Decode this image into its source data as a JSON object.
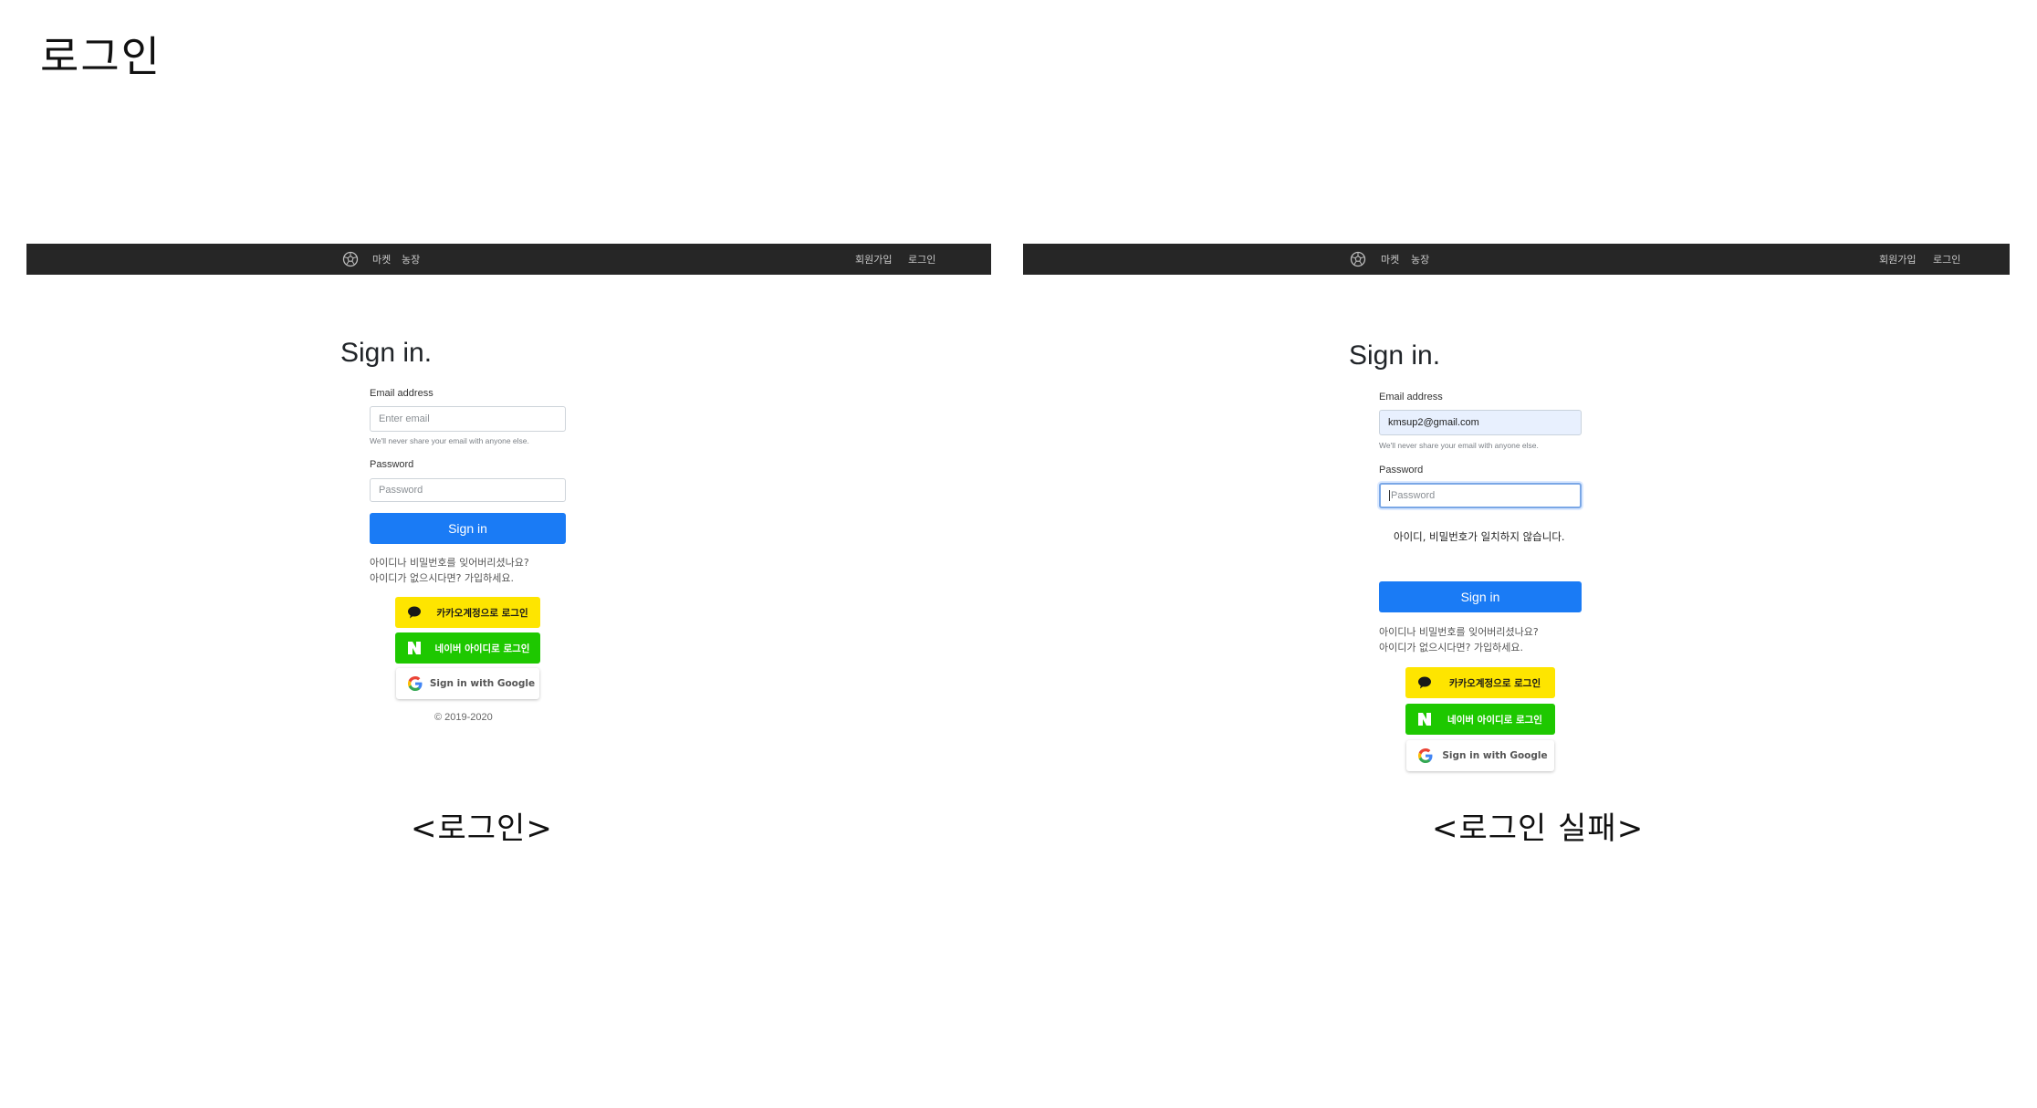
{
  "slide": {
    "title": "로그인"
  },
  "captions": {
    "left": "<로그인>",
    "right": "<로그인 실패>"
  },
  "nav": {
    "brand_icon": "soccer-ball-icon",
    "links_left": [
      "마켓",
      "농장"
    ],
    "links_right": [
      "회원가입",
      "로그인"
    ]
  },
  "login_form": {
    "title": "Sign in.",
    "email_label": "Email address",
    "email_placeholder": "Enter email",
    "email_help": "We'll never share your email with anyone else.",
    "password_label": "Password",
    "password_placeholder": "Password",
    "submit_label": "Sign in",
    "forgot_text": "아이디나 비밀번호를 잊어버리셨나요?",
    "signup_text": "아이디가 없으시다면? 가입하세요.",
    "kakao_label": "카카오계정으로 로그인",
    "naver_label": "네이버 아이디로 로그인",
    "google_label": "Sign in with Google",
    "copyright": "© 2019-2020"
  },
  "failed_form": {
    "title": "Sign in.",
    "email_label": "Email address",
    "email_value": "kmsup2@gmail.com",
    "email_help": "We'll never share your email with anyone else.",
    "password_label": "Password",
    "password_placeholder": "Password",
    "error_message": "아이디, 비밀번호가 일치하지 않습니다.",
    "submit_label": "Sign in",
    "forgot_text": "아이디나 비밀번호를 잊어버리셨나요?",
    "signup_text": "아이디가 없으시다면? 가입하세요.",
    "kakao_label": "카카오계정으로 로그인",
    "naver_label": "네이버 아이디로 로그인",
    "google_label": "Sign in with Google"
  },
  "colors": {
    "navbar": "#262626",
    "primary": "#1a7bf5",
    "kakao": "#fee500",
    "naver": "#1ec800"
  }
}
